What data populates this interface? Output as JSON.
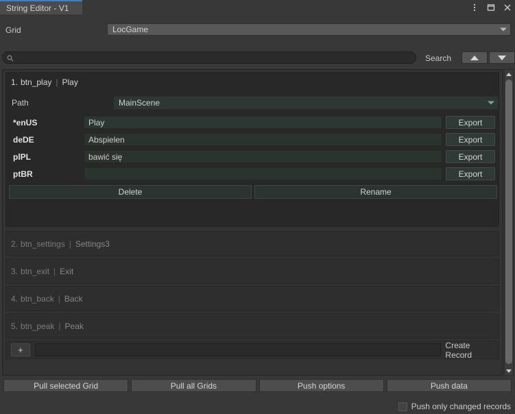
{
  "window": {
    "tab_title": "String Editor - V1",
    "controls": [
      {
        "name": "kebab-menu-icon",
        "glyph": "⋮"
      },
      {
        "name": "maximize-icon",
        "glyph": "□"
      },
      {
        "name": "close-icon",
        "glyph": "✕"
      }
    ]
  },
  "grid": {
    "label": "Grid",
    "selected": "LocGame"
  },
  "search": {
    "value": "",
    "placeholder": "",
    "label": "Search",
    "prev_icon": "triangle-up-icon",
    "next_icon": "triangle-down-icon"
  },
  "expanded_record": {
    "index": "1.",
    "key": "btn_play",
    "separator": "|",
    "preview": "Play",
    "path_label": "Path",
    "path_value": "MainScene",
    "export_label": "Export",
    "locales": [
      {
        "code": "*enUS",
        "value": "Play"
      },
      {
        "code": "deDE",
        "value": "Abspielen"
      },
      {
        "code": "plPL",
        "value": "bawić się"
      },
      {
        "code": "ptBR",
        "value": ""
      }
    ],
    "delete_label": "Delete",
    "rename_label": "Rename"
  },
  "collapsed_records": [
    {
      "index": "2.",
      "key": "btn_settings",
      "separator": "|",
      "preview": "Settings3"
    },
    {
      "index": "3.",
      "key": "btn_exit",
      "separator": "|",
      "preview": "Exit"
    },
    {
      "index": "4.",
      "key": "btn_back",
      "separator": "|",
      "preview": "Back"
    },
    {
      "index": "5.",
      "key": "btn_peak",
      "separator": "|",
      "preview": "Peak"
    }
  ],
  "create_record": {
    "plus_label": "+",
    "input_value": "",
    "label": "Create Record"
  },
  "bottom_toolbar": {
    "buttons": [
      {
        "label": "Pull selected Grid"
      },
      {
        "label": "Pull all Grids"
      },
      {
        "label": "Push options"
      },
      {
        "label": "Push data"
      }
    ],
    "checkbox_label": "Push only changed records",
    "checkbox_checked": false
  },
  "colors": {
    "tab_accent": "#4a7fb5",
    "window_bg": "#383838",
    "panel_bg": "#333333",
    "record_bg": "#282828",
    "field_teal": "#2b332f"
  }
}
